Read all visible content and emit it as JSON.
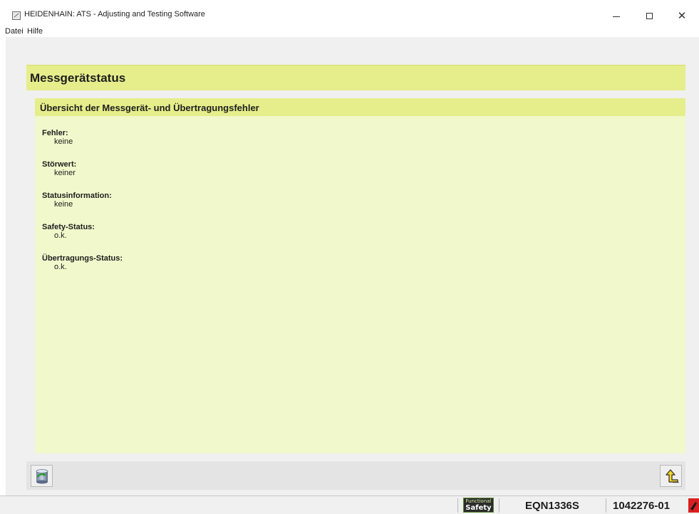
{
  "window": {
    "title": "HEIDENHAIN: ATS - Adjusting and Testing Software",
    "icon": "heidenhain-app-icon"
  },
  "menu": {
    "items": [
      {
        "label": "Datei"
      },
      {
        "label": "Hilfe"
      }
    ]
  },
  "page": {
    "title": "Messgerätstatus",
    "panel_title": "Übersicht der Messgerät- und Übertragungsfehler",
    "colors": {
      "header_bg": "#e6ee8b",
      "panel_bg": "#f1f8cb"
    },
    "status_items": [
      {
        "label": "Fehler:",
        "value": "keine"
      },
      {
        "label": "Störwert:",
        "value": "keiner"
      },
      {
        "label": "Statusinformation:",
        "value": "keine"
      },
      {
        "label": "Safety-Status:",
        "value": "o.k."
      },
      {
        "label": "Übertragungs-Status:",
        "value": "o.k."
      }
    ]
  },
  "toolbar": {
    "left_icon": "database-refresh-icon",
    "right_icon": "back-arrow-icon"
  },
  "statusbar": {
    "safety_badge_top": "Functional",
    "safety_badge_bottom": "Safety",
    "device_name": "EQN1336S",
    "device_id": "1042276-01",
    "connection_icon": "connection-status-icon"
  }
}
